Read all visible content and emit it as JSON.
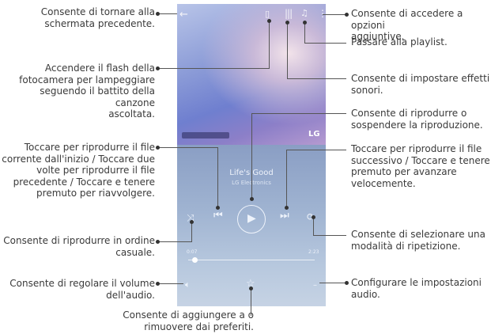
{
  "phone": {
    "song_title": "Life's Good",
    "song_artist": "LG Electronics",
    "time_elapsed": "0:07",
    "time_total": "2:23",
    "progress": 0.05,
    "logo": "LG",
    "icons": [
      "back-icon",
      "flash-icon",
      "equalizer-icon",
      "more-icon",
      "playlist-icon",
      "previous-icon",
      "play-icon",
      "next-icon",
      "shuffle-icon",
      "repeat-icon",
      "volume-icon",
      "favorite-star-icon",
      "audio-settings-icon"
    ]
  },
  "callouts": {
    "back": "Consente di tornare alla\nschermata precedente.",
    "flash": "Accendere il flash della\nfotocamera per lampeggiare\nseguendo il battito della canzone\nascoltata.",
    "previous": "Toccare per riprodurre il file\ncorrente dall'inizio / Toccare due\nvolte per riprodurre il file\nprecedente / Toccare e tenere\npremuto per riavvolgere.",
    "shuffle": "Consente di riprodurre in ordine\ncasuale.",
    "volume": "Consente di regolare il volume\ndell'audio.",
    "favorite": "Consente di aggiungere a o\nrimuovere dai preferiti.",
    "more": "Consente di accedere a opzioni\naggiuntive.",
    "playlist": "Passare alla playlist.",
    "sound_effects": "Consente di impostare effetti\nsonori.",
    "play_pause": "Consente di riprodurre o\nsospendere la riproduzione.",
    "next": "Toccare per riprodurre il file\nsuccessivo / Toccare e tenere\npremuto per avanzare\nvelocemente.",
    "repeat": "Consente di selezionare una\nmodalità di ripetizione.",
    "audio_settings": "Configurare le impostazioni\naudio."
  }
}
